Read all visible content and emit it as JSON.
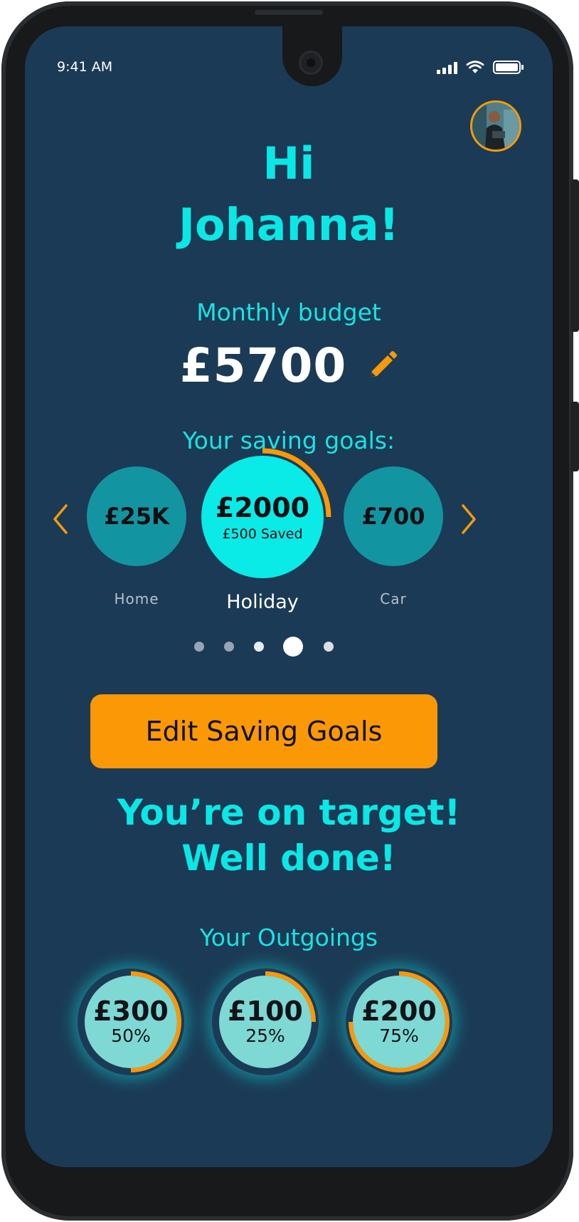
{
  "status_bar": {
    "time": "9:41 AM"
  },
  "greeting": {
    "line1": "Hi",
    "line2": "Johanna!"
  },
  "budget": {
    "label": "Monthly budget",
    "value": "£5700"
  },
  "saving_goals": {
    "label": "Your saving goals:",
    "items": [
      {
        "amount": "£25K",
        "name": "Home"
      },
      {
        "amount": "£2000",
        "saved": "£500 Saved",
        "name": "Holiday",
        "progress": 0.25
      },
      {
        "amount": "£700",
        "name": "Car"
      }
    ],
    "page_count": 5,
    "active_page": 4
  },
  "edit_button": {
    "label": "Edit Saving Goals"
  },
  "message": {
    "line1": "You’re on target!",
    "line2": "Well done!"
  },
  "outgoings": {
    "label": "Your Outgoings",
    "items": [
      {
        "amount": "£300",
        "percent": "50%",
        "progress": 0.5
      },
      {
        "amount": "£100",
        "percent": "25%",
        "progress": 0.25
      },
      {
        "amount": "£200",
        "percent": "75%",
        "progress": 0.75
      }
    ]
  },
  "colors": {
    "accent": "#0ae8e6",
    "orange": "#fb9806",
    "background": "#1b3a55",
    "goal_circle": "#1394a1",
    "outgoing_fill": "#7ed8d4"
  },
  "icons": {
    "edit": "pencil-icon",
    "prev": "chevron-left-icon",
    "next": "chevron-right-icon"
  }
}
